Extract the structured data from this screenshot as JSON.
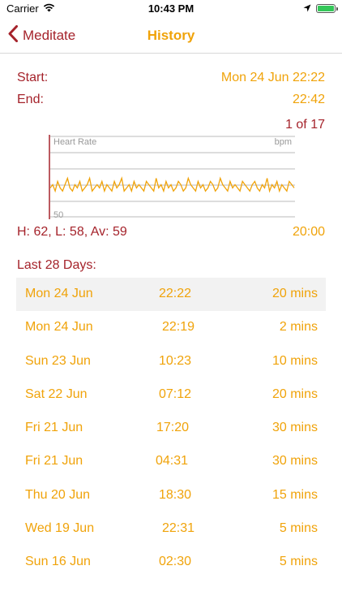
{
  "status_bar": {
    "carrier": "Carrier",
    "time": "10:43 PM"
  },
  "nav": {
    "back_label": "Meditate",
    "title": "History"
  },
  "session": {
    "start_label": "Start:",
    "start_value": "Mon 24 Jun 22:22",
    "end_label": "End:",
    "end_value": "22:42",
    "page_indicator": "1 of 17"
  },
  "chart_data": {
    "type": "line",
    "title": "Heart Rate",
    "unit_label": "bpm",
    "y_tick_label": "50",
    "series": [
      {
        "values": [
          59,
          60,
          58,
          61,
          59,
          58,
          60,
          62,
          59,
          58,
          60,
          59,
          61,
          58,
          59,
          60,
          62,
          58,
          59,
          60,
          59,
          61,
          58,
          60,
          59,
          58,
          61,
          59,
          60,
          62,
          58,
          59,
          60,
          58,
          61,
          59,
          60,
          59,
          58,
          61,
          60,
          59,
          58,
          62,
          59,
          60,
          58,
          61,
          59,
          60,
          58,
          59,
          61,
          60,
          58,
          59,
          62,
          60,
          59,
          58,
          61,
          59,
          60,
          58,
          59,
          61,
          60,
          58,
          59,
          62,
          60,
          59,
          58,
          61,
          59,
          60,
          59,
          58,
          61,
          60,
          59,
          58,
          60,
          61,
          59,
          58,
          60,
          59,
          62,
          58,
          60,
          59,
          61,
          58,
          60,
          59,
          58,
          61,
          60,
          59
        ]
      }
    ],
    "ylim": [
      50,
      75
    ],
    "colors": {
      "line": "#f0a30a",
      "grid": "#bbbbbb",
      "axis": "#a5232b"
    }
  },
  "stats": {
    "summary": "H: 62, L: 58, Av: 59",
    "duration": "20:00"
  },
  "history": {
    "header": "Last 28 Days:",
    "rows": [
      {
        "date": "Mon 24 Jun",
        "time": "22:22",
        "duration": "20 mins"
      },
      {
        "date": "Mon 24 Jun",
        "time": "22:19",
        "duration": "2 mins"
      },
      {
        "date": "Sun 23 Jun",
        "time": "10:23",
        "duration": "10 mins"
      },
      {
        "date": "Sat 22 Jun",
        "time": "07:12",
        "duration": "20 mins"
      },
      {
        "date": "Fri 21 Jun",
        "time": "17:20",
        "duration": "30 mins"
      },
      {
        "date": "Fri 21 Jun",
        "time": "04:31",
        "duration": "30 mins"
      },
      {
        "date": "Thu 20 Jun",
        "time": "18:30",
        "duration": "15 mins"
      },
      {
        "date": "Wed 19 Jun",
        "time": "22:31",
        "duration": "5 mins"
      },
      {
        "date": "Sun 16 Jun",
        "time": "02:30",
        "duration": "5 mins"
      }
    ]
  },
  "colors": {
    "accent_red": "#a5232b",
    "accent_orange": "#f0a30a",
    "selected_row_bg": "#f2f2f2"
  }
}
